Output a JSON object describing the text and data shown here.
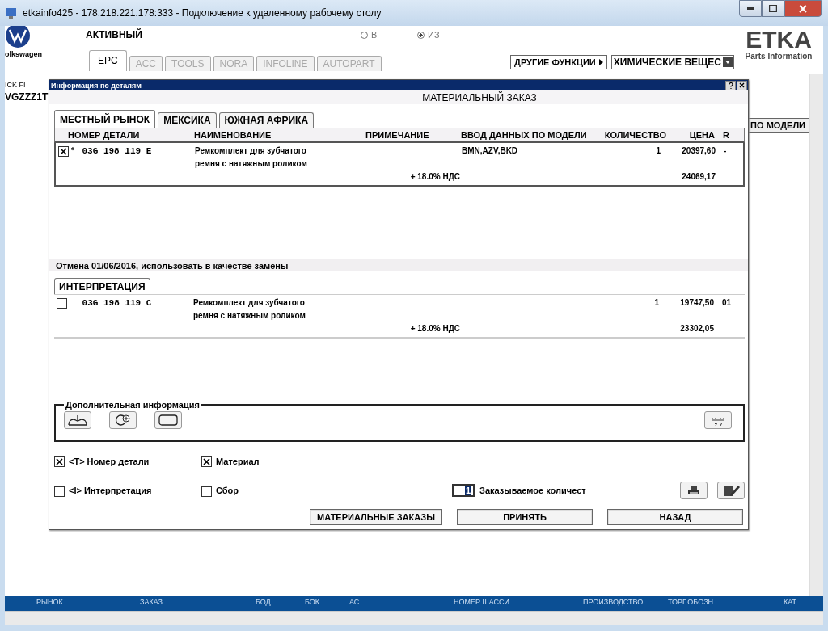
{
  "window": {
    "title": "etkainfo425 - 178.218.221.178:333 - Подключение к удаленному рабочему столу"
  },
  "app": {
    "brand": "olkswagen",
    "status": "АКТИВНЫЙ",
    "radios": [
      {
        "label": "В",
        "selected": false
      },
      {
        "label": "ИЗ",
        "selected": true
      }
    ],
    "tabs": [
      {
        "label": "EPC",
        "selected": true,
        "disabled": false
      },
      {
        "label": "ACC",
        "selected": false,
        "disabled": true
      },
      {
        "label": "TOOLS",
        "selected": false,
        "disabled": true
      },
      {
        "label": "NORA",
        "selected": false,
        "disabled": true
      },
      {
        "label": "INFOLINE",
        "selected": false,
        "disabled": true
      },
      {
        "label": "AUTOPART",
        "selected": false,
        "disabled": true
      }
    ],
    "other_functions": "ДРУГИЕ ФУНКЦИИ",
    "dropdown_value": "ХИМИЧЕСКИЕ ВЕЩЕС",
    "logo": {
      "name": "ETKA",
      "subtitle": "Parts Information"
    },
    "fields": [
      "ICK FI",
      "VGZZZ1T"
    ],
    "model_button": "ПО МОДЕЛИ",
    "status_bar": [
      "РЫНОК",
      "ЗАКАЗ",
      "БОД",
      "БОК",
      "АС",
      "НОМЕР ШАССИ",
      "ПРОИЗВОДСТВО",
      "ТОРГ.ОБОЗН.",
      "КАТ"
    ]
  },
  "dialog": {
    "title": "Информация по деталям",
    "heading": "МАТЕРИАЛЬНЫЙ ЗАКАЗ",
    "market_tabs": [
      {
        "label": "МЕСТНЫЙ РЫНОК",
        "selected": true
      },
      {
        "label": "МЕКСИКА",
        "selected": false
      },
      {
        "label": "ЮЖНАЯ АФРИКА",
        "selected": false
      }
    ],
    "columns": [
      "НОМЕР ДЕТАЛИ",
      "НАИМЕНОВАНИЕ",
      "ПРИМЕЧАНИЕ",
      "ВВОД ДАННЫХ ПО МОДЕЛИ",
      "КОЛИЧЕСТВО",
      "ЦЕНА",
      "R"
    ],
    "rows": [
      {
        "checked": true,
        "mark": "*",
        "part_number": "03G 198 119 E",
        "name": [
          "Ремкомплект для зубчатого",
          "ремня с натяжным роликом"
        ],
        "model_data": "BMN,AZV,BKD",
        "quantity": "1",
        "price": "20397,60",
        "r": "-",
        "vat": "+ 18.0% НДС",
        "price_with_vat": "24069,17"
      }
    ],
    "notice": "Отмена 01/06/2016, использовать в качестве замены",
    "interp_tab": "ИНТЕРПРЕТАЦИЯ",
    "interp_rows": [
      {
        "checked": false,
        "part_number": "03G 198 119 C",
        "name": [
          "Ремкомплект для зубчатого",
          "ремня с натяжным роликом"
        ],
        "quantity": "1",
        "price": "19747,50",
        "r": "01",
        "vat": "+ 18.0% НДС",
        "price_with_vat": "23302,05"
      }
    ],
    "extra_info": "Дополнительная информация",
    "options": [
      {
        "label": "<T> Номер детали",
        "checked": true
      },
      {
        "label": "Материал",
        "checked": true
      },
      {
        "label": "<I> Интерпретация",
        "checked": false
      },
      {
        "label": "Сбор",
        "checked": false
      }
    ],
    "quantity": {
      "value": "1",
      "label": "Заказываемое количест"
    },
    "buttons": [
      "МАТЕРИАЛЬНЫЕ ЗАКАЗЫ",
      "ПРИНЯТЬ",
      "НАЗАД"
    ]
  }
}
